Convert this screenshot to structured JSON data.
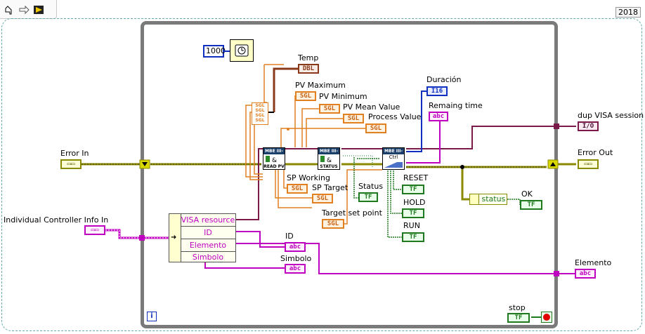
{
  "version_label": "2018",
  "toolbar": {
    "icons": [
      "highlight-execution-icon",
      "step-arrow-icon",
      "block-diagram-run-icon"
    ]
  },
  "wait_constant": "1000",
  "indicators": {
    "temp": {
      "label": "Temp",
      "type": "DBL"
    },
    "pv_maximum": {
      "label": "PV Maximum",
      "type": "SGL"
    },
    "pv_minimum": {
      "label": "PV Minimum",
      "type": "SGL"
    },
    "pv_mean": {
      "label": "PV Mean Value",
      "type": "SGL"
    },
    "process_value": {
      "label": "Process Value",
      "type": "SGL"
    },
    "sp_working": {
      "label": "SP Working",
      "type": "SGL"
    },
    "sp_target": {
      "label": "SP Target",
      "type": "SGL"
    },
    "duracion": {
      "label": "Duración",
      "type": "I16"
    },
    "remaining": {
      "label": "Remaing time",
      "type": "abc"
    },
    "status": {
      "label": "Status",
      "type": "TF"
    },
    "reset": {
      "label": "RESET",
      "type": "TF"
    },
    "hold": {
      "label": "HOLD",
      "type": "TF"
    },
    "run": {
      "label": "RUN",
      "type": "TF"
    },
    "ok": {
      "label": "OK",
      "type": "TF"
    },
    "id": {
      "label": "ID",
      "type": "abc"
    },
    "simbolo": {
      "label": "Simbolo",
      "type": "abc"
    }
  },
  "controls": {
    "target_set_point": {
      "label": "Target set point",
      "type": "SGL"
    },
    "error_in": {
      "label": "Error In"
    },
    "controller_info": {
      "label": "Individual Controller Info In"
    }
  },
  "outputs": {
    "dup_visa": {
      "label": "dup VISA session",
      "type": "I/O"
    },
    "error_out": {
      "label": "Error Out"
    },
    "elemento": {
      "label": "Elemento",
      "type": "abc"
    }
  },
  "unbundle": {
    "items": [
      "VISA resource",
      "ID",
      "Elemento",
      "Simbolo"
    ]
  },
  "subvis": {
    "read_pv": {
      "header": "MBE III-V",
      "caption": "READ PV"
    },
    "status": {
      "header": "MBE III-V",
      "caption": "STATUS"
    },
    "ctrl": {
      "header": "MBE III-V",
      "caption": "Ctrl"
    }
  },
  "status_node": "status",
  "stop_label": "stop",
  "loop_iteration": "i",
  "colors": {
    "error_wire": "#8a8a00",
    "visa_wire": "#7a1a4a",
    "sgl_wire": "#e08020",
    "string_wire": "#c000c0",
    "bool_wire": "#1f7a1f",
    "int_wire": "#1030c0",
    "dbl_wire": "#8a3a1a",
    "loop_border": "#7a7a7a"
  }
}
